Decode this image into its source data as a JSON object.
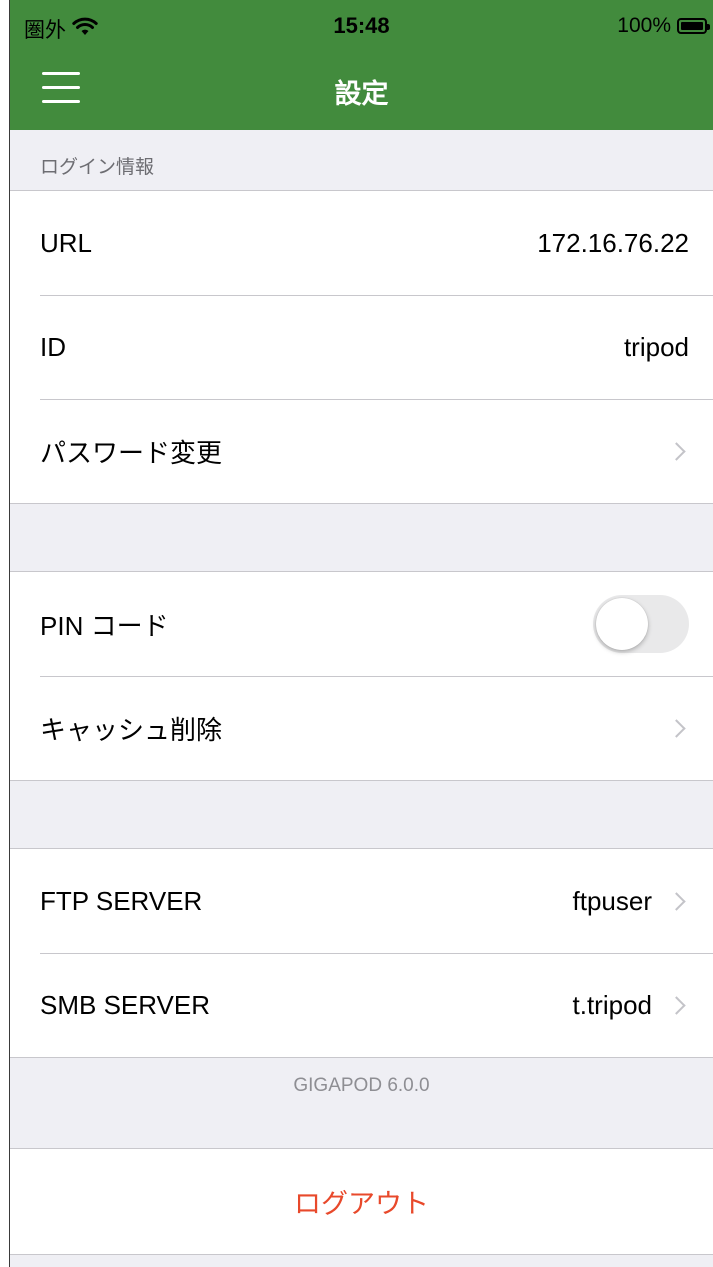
{
  "status_bar": {
    "carrier": "圏外",
    "time": "15:48",
    "battery": "100%",
    "battery_level": 1.0,
    "wifi_icon": "wifi-icon",
    "battery_icon": "battery-icon"
  },
  "nav": {
    "title": "設定",
    "menu_icon": "hamburger-menu-icon",
    "bar_color": "#428b3d"
  },
  "sections": {
    "login_header": "ログイン情報"
  },
  "login": {
    "url_label": "URL",
    "url_value": "172.16.76.22",
    "id_label": "ID",
    "id_value": "tripod",
    "password_label": "パスワード変更"
  },
  "security": {
    "pin_label": "PIN コード",
    "pin_enabled": false,
    "cache_label": "キャッシュ削除"
  },
  "servers": {
    "ftp_label": "FTP SERVER",
    "ftp_value": "ftpuser",
    "smb_label": "SMB SERVER",
    "smb_value": "t.tripod"
  },
  "footer": {
    "version": "GIGAPOD 6.0.0",
    "logout_label": "ログアウト",
    "logout_color": "#e8492b"
  }
}
